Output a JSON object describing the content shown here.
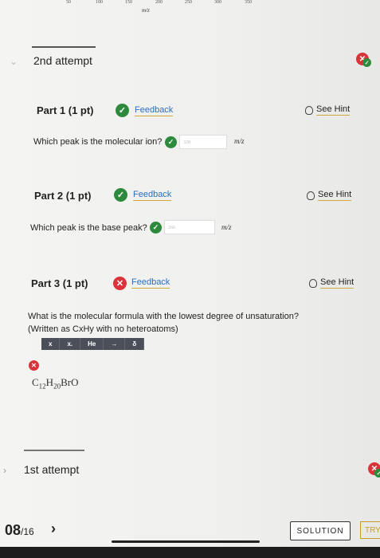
{
  "axis": {
    "ticks": [
      "50",
      "100",
      "150",
      "200",
      "250",
      "300",
      "350"
    ],
    "label": "m/z"
  },
  "attempt2": {
    "title": "2nd attempt",
    "parts": [
      {
        "title": "Part 1 (1 pt)",
        "feedback": "Feedback",
        "hint": "See Hint",
        "question": "Which peak is the molecular ion?",
        "answer": "328",
        "unit": "m/z"
      },
      {
        "title": "Part 2 (1 pt)",
        "feedback": "Feedback",
        "hint": "See Hint",
        "question": "Which peak is the base peak?",
        "answer": "266",
        "unit": "m/z"
      },
      {
        "title": "Part 3 (1 pt)",
        "feedback": "Feedback",
        "hint": "See Hint",
        "question": "What is the molecular formula with the lowest degree of unsaturation?",
        "question2": "(Written as CxHy with no heteroatoms)",
        "toolbar": [
          "x",
          "x.",
          "He",
          "→",
          "δ"
        ],
        "formula": {
          "c": "C",
          "c_sub": "12",
          "h": "H",
          "h_sub": "20",
          "rest": "BrO"
        }
      }
    ]
  },
  "attempt1": {
    "title": "1st attempt"
  },
  "footer": {
    "page_current": "08",
    "page_total": "/16",
    "next": "›",
    "solution": "SOLUTION",
    "try": "TRY"
  },
  "colors": {
    "success": "#2d8a3d",
    "error": "#d9343a",
    "link": "#2a6ebb",
    "accent": "#c89c2a"
  }
}
